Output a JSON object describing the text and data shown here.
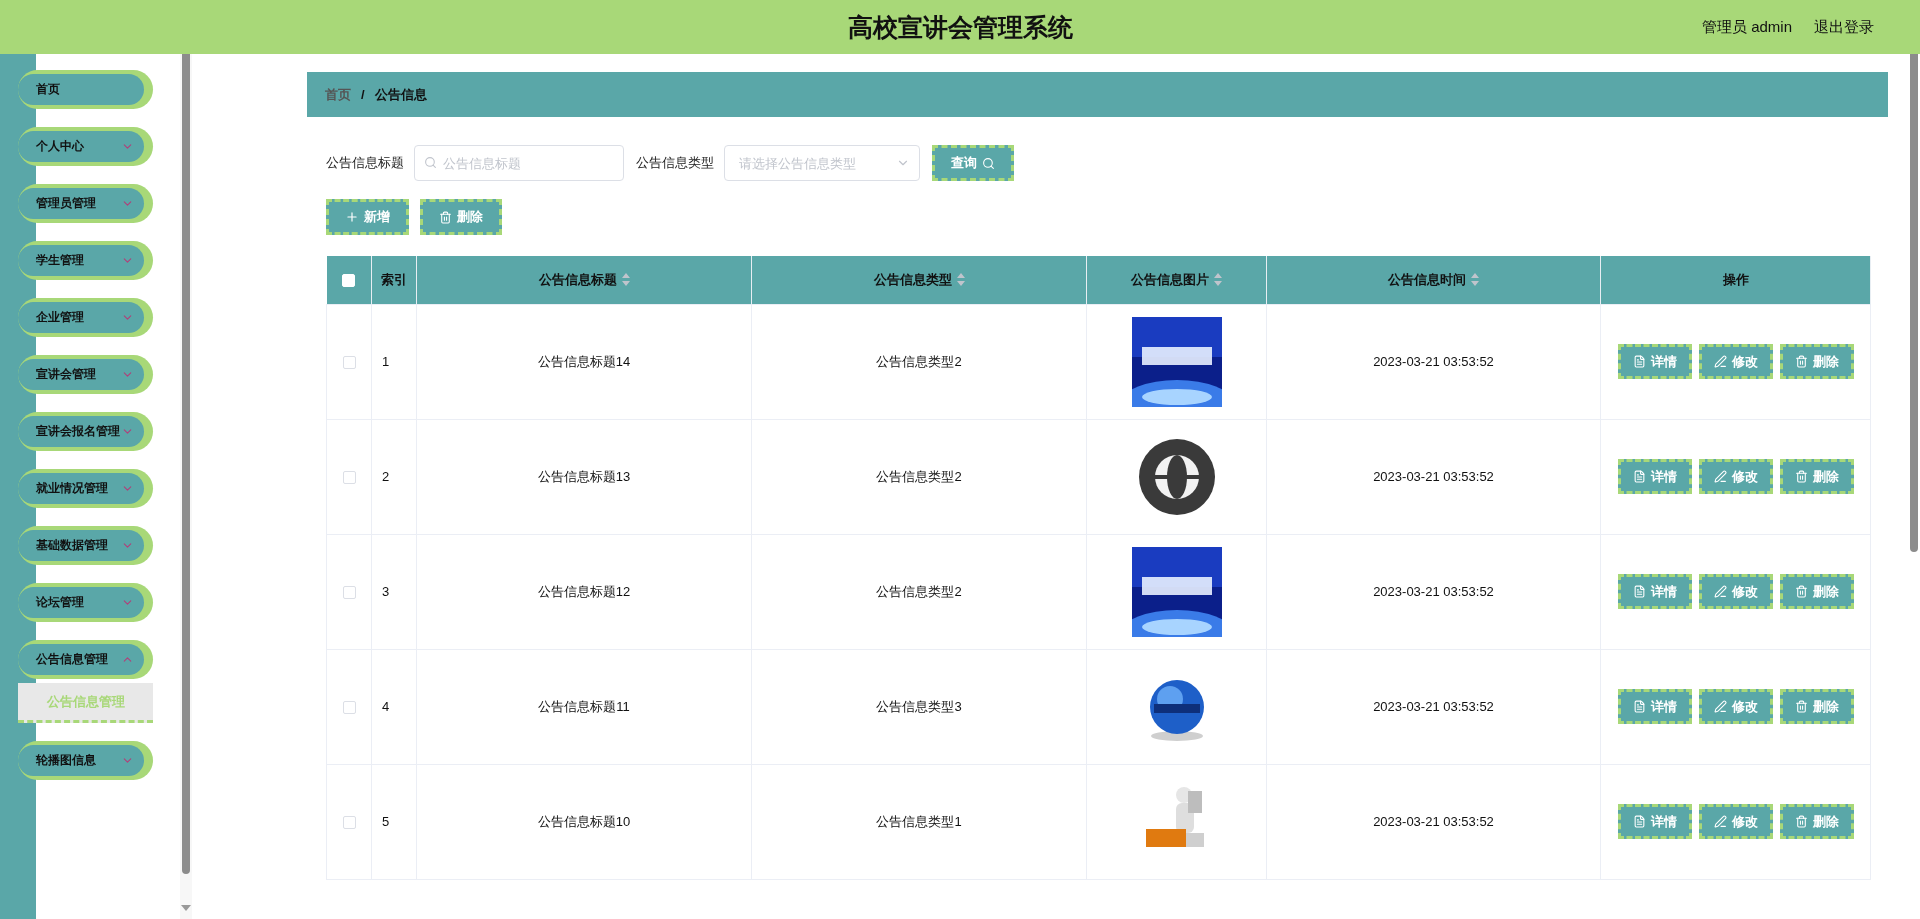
{
  "header": {
    "title": "高校宣讲会管理系统",
    "user": "管理员 admin",
    "logout": "退出登录"
  },
  "sidebar": {
    "items": [
      {
        "kind": "link",
        "label": "首页"
      },
      {
        "kind": "menu",
        "label": "个人中心",
        "expanded": false
      },
      {
        "kind": "menu",
        "label": "管理员管理",
        "expanded": false
      },
      {
        "kind": "menu",
        "label": "学生管理",
        "expanded": false
      },
      {
        "kind": "menu",
        "label": "企业管理",
        "expanded": false
      },
      {
        "kind": "menu",
        "label": "宣讲会管理",
        "expanded": false
      },
      {
        "kind": "menu",
        "label": "宣讲会报名管理",
        "expanded": false
      },
      {
        "kind": "menu",
        "label": "就业情况管理",
        "expanded": false
      },
      {
        "kind": "menu",
        "label": "基础数据管理",
        "expanded": false
      },
      {
        "kind": "menu",
        "label": "论坛管理",
        "expanded": false
      },
      {
        "kind": "menu",
        "label": "公告信息管理",
        "expanded": true,
        "children": [
          {
            "label": "公告信息管理",
            "selected": true
          }
        ]
      },
      {
        "kind": "menu",
        "label": "轮播图信息",
        "expanded": false
      }
    ]
  },
  "breadcrumb": [
    "首页",
    "公告信息"
  ],
  "breadcrumb_separator": "/",
  "search": {
    "fields": [
      {
        "kind": "text",
        "label": "公告信息标题",
        "placeholder": "公告信息标题"
      },
      {
        "kind": "select",
        "label": "公告信息类型",
        "placeholder": "请选择公告信息类型"
      }
    ],
    "button": "查询"
  },
  "actions": [
    {
      "kind": "add",
      "label": "新增"
    },
    {
      "kind": "delete",
      "label": "删除"
    }
  ],
  "table": {
    "select_all": {
      "checked": false
    },
    "columns": [
      {
        "label": "索引",
        "sortable": false
      },
      {
        "label": "公告信息标题",
        "sortable": true
      },
      {
        "label": "公告信息类型",
        "sortable": true
      },
      {
        "label": "公告信息图片",
        "sortable": true
      },
      {
        "label": "公告信息时间",
        "sortable": true
      },
      {
        "label": "操作",
        "sortable": false
      }
    ],
    "rows": [
      {
        "checked": false,
        "index": "1",
        "title": "公告信息标题14",
        "type": "公告信息类型2",
        "time": "2023-03-21 03:53:52",
        "actions": [
          {
            "kind": "detail",
            "label": "详情"
          },
          {
            "kind": "edit",
            "label": "修改"
          },
          {
            "kind": "delete",
            "label": "删除"
          }
        ]
      },
      {
        "checked": false,
        "index": "2",
        "title": "公告信息标题13",
        "type": "公告信息类型2",
        "time": "2023-03-21 03:53:52",
        "actions": [
          {
            "kind": "detail",
            "label": "详情"
          },
          {
            "kind": "edit",
            "label": "修改"
          },
          {
            "kind": "delete",
            "label": "删除"
          }
        ]
      },
      {
        "checked": false,
        "index": "3",
        "title": "公告信息标题12",
        "type": "公告信息类型2",
        "time": "2023-03-21 03:53:52",
        "actions": [
          {
            "kind": "detail",
            "label": "详情"
          },
          {
            "kind": "edit",
            "label": "修改"
          },
          {
            "kind": "delete",
            "label": "删除"
          }
        ]
      },
      {
        "checked": false,
        "index": "4",
        "title": "公告信息标题11",
        "type": "公告信息类型3",
        "time": "2023-03-21 03:53:52",
        "actions": [
          {
            "kind": "detail",
            "label": "详情"
          },
          {
            "kind": "edit",
            "label": "修改"
          },
          {
            "kind": "delete",
            "label": "删除"
          }
        ]
      },
      {
        "checked": false,
        "index": "5",
        "title": "公告信息标题10",
        "type": "公告信息类型1",
        "time": "2023-03-21 03:53:52",
        "actions": [
          {
            "kind": "detail",
            "label": "详情"
          },
          {
            "kind": "edit",
            "label": "修改"
          },
          {
            "kind": "delete",
            "label": "删除"
          }
        ]
      }
    ]
  }
}
